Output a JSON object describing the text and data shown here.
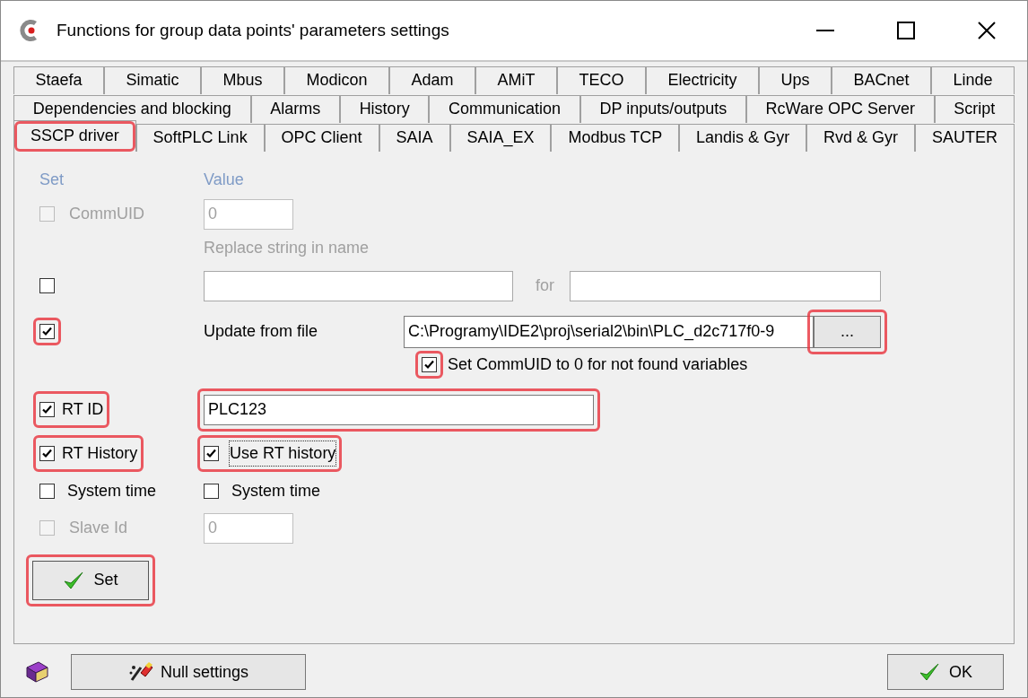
{
  "window": {
    "title": "Functions for group data points' parameters settings"
  },
  "tab_rows": [
    [
      {
        "label": "Staefa",
        "selected": false
      },
      {
        "label": "Simatic",
        "selected": false
      },
      {
        "label": "Mbus",
        "selected": false
      },
      {
        "label": "Modicon",
        "selected": false
      },
      {
        "label": "Adam",
        "selected": false
      },
      {
        "label": "AMiT",
        "selected": false
      },
      {
        "label": "TECO",
        "selected": false
      },
      {
        "label": "Electricity",
        "selected": false
      },
      {
        "label": "Ups",
        "selected": false
      },
      {
        "label": "BACnet",
        "selected": false
      },
      {
        "label": "Linde",
        "selected": false
      }
    ],
    [
      {
        "label": "Dependencies and blocking",
        "selected": false
      },
      {
        "label": "Alarms",
        "selected": false
      },
      {
        "label": "History",
        "selected": false
      },
      {
        "label": "Communication",
        "selected": false
      },
      {
        "label": "DP inputs/outputs",
        "selected": false
      },
      {
        "label": "RcWare OPC Server",
        "selected": false
      },
      {
        "label": "Script",
        "selected": false
      }
    ],
    [
      {
        "label": "SSCP driver",
        "selected": true,
        "highlighted": true
      },
      {
        "label": "SoftPLC Link",
        "selected": false,
        "highlighted": false
      },
      {
        "label": "OPC Client",
        "selected": false,
        "highlighted": false
      },
      {
        "label": "SAIA",
        "selected": false,
        "highlighted": false
      },
      {
        "label": "SAIA_EX",
        "selected": false,
        "highlighted": false
      },
      {
        "label": "Modbus TCP",
        "selected": false,
        "highlighted": false
      },
      {
        "label": "Landis & Gyr",
        "selected": false,
        "highlighted": false
      },
      {
        "label": "Rvd & Gyr",
        "selected": false,
        "highlighted": false
      },
      {
        "label": "SAUTER",
        "selected": false,
        "highlighted": false
      }
    ]
  ],
  "form": {
    "headers": [
      "Set",
      "Value"
    ],
    "commuid": {
      "checked": false,
      "disabled": true,
      "label": "CommUID",
      "value": "0"
    },
    "replace": {
      "checked": false,
      "title": "Replace string in name",
      "for_label": "for"
    },
    "update": {
      "checked": true,
      "highlighted": true,
      "label": "Update from file",
      "path": "C:\\Programy\\IDE2\\proj\\serial2\\bin\\PLC_d2c717f0-9",
      "browse": "...",
      "browse_highlighted": true,
      "sub": {
        "checked": true,
        "highlighted": true,
        "label": "Set CommUID to 0 for not found variables"
      }
    },
    "rt_id": {
      "checked": true,
      "highlighted": true,
      "label": "RT ID",
      "value": "PLC123",
      "value_highlighted": true
    },
    "rt_history": {
      "checked": true,
      "highlighted": true,
      "label": "RT History",
      "use": {
        "checked": true,
        "highlighted": true,
        "focused": true,
        "label": "Use RT history"
      }
    },
    "system_time": {
      "checked": false,
      "label": "System time",
      "value": {
        "checked": false,
        "label": "System time"
      }
    },
    "slave_id": {
      "checked": false,
      "disabled": true,
      "label": "Slave Id",
      "value": "0"
    },
    "set_button": {
      "label": "Set",
      "highlighted": true
    }
  },
  "footer": {
    "null_button": "Null settings",
    "ok_button": "OK"
  }
}
